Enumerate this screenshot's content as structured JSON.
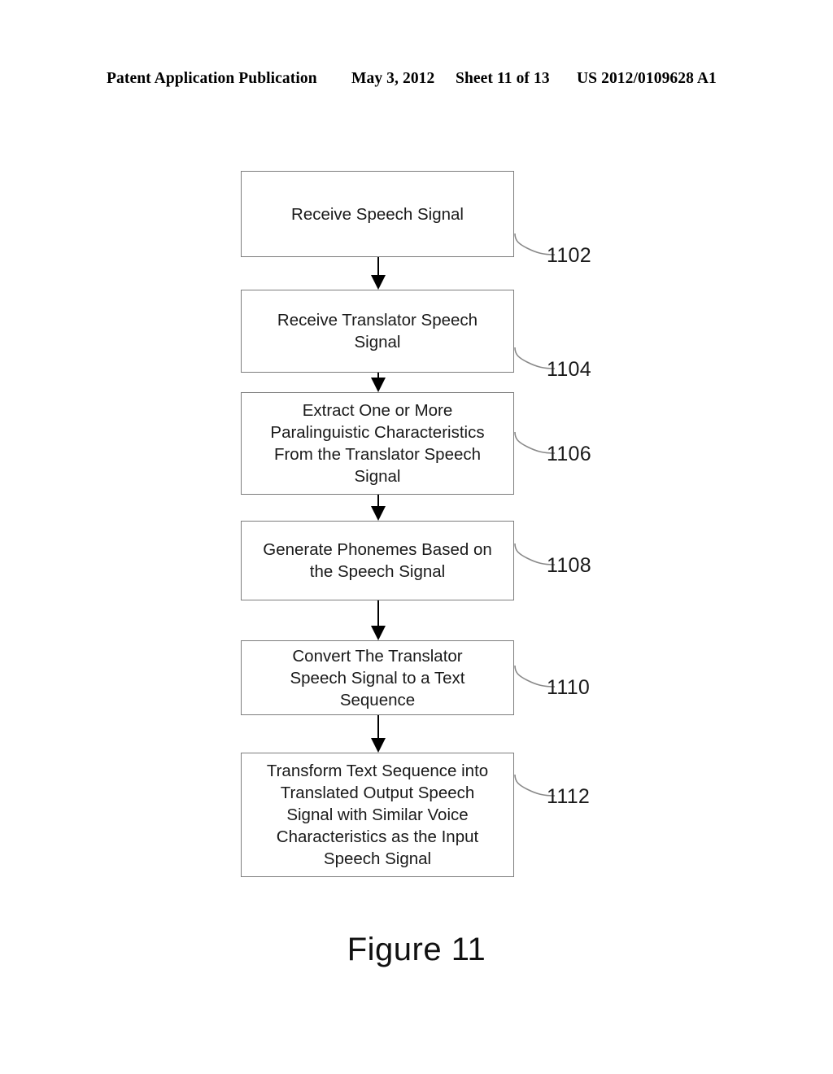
{
  "document": {
    "header": {
      "publication": "Patent Application Publication",
      "date": "May 3, 2012",
      "sheet": "Sheet 11 of 13",
      "publication_number": "US 2012/0109628 A1"
    },
    "figure_caption": "Figure 11"
  },
  "diagram_data": {
    "type": "flowchart",
    "orientation": "vertical",
    "title": "Figure 11",
    "node_shape": "rectangle",
    "connector": "arrow-down",
    "nodes": [
      {
        "ref": "1102",
        "label": "Receive Speech Signal",
        "lines": 1
      },
      {
        "ref": "1104",
        "label": "Receive Translator Speech\nSignal",
        "lines": 2
      },
      {
        "ref": "1106",
        "label": "Extract One or More\nParalinguistic Characteristics\nFrom the Translator Speech\nSignal",
        "lines": 4
      },
      {
        "ref": "1108",
        "label": "Generate Phonemes Based on\nthe Speech Signal",
        "lines": 2
      },
      {
        "ref": "1110",
        "label": "Convert The Translator\nSpeech Signal to a Text\nSequence",
        "lines": 3
      },
      {
        "ref": "1112",
        "label": "Transform Text Sequence into\nTranslated Output Speech\nSignal with Similar Voice\nCharacteristics as the Input\nSpeech Signal",
        "lines": 5
      }
    ],
    "edges": [
      {
        "from": "1102",
        "to": "1104"
      },
      {
        "from": "1104",
        "to": "1106"
      },
      {
        "from": "1106",
        "to": "1108"
      },
      {
        "from": "1108",
        "to": "1110"
      },
      {
        "from": "1110",
        "to": "1112"
      }
    ],
    "colors": {
      "background": "#ffffff",
      "box_border": "#7d7d7d",
      "text": "#1a1a1a",
      "arrow": "#000000",
      "leader_line": "#8a8a8a"
    }
  }
}
